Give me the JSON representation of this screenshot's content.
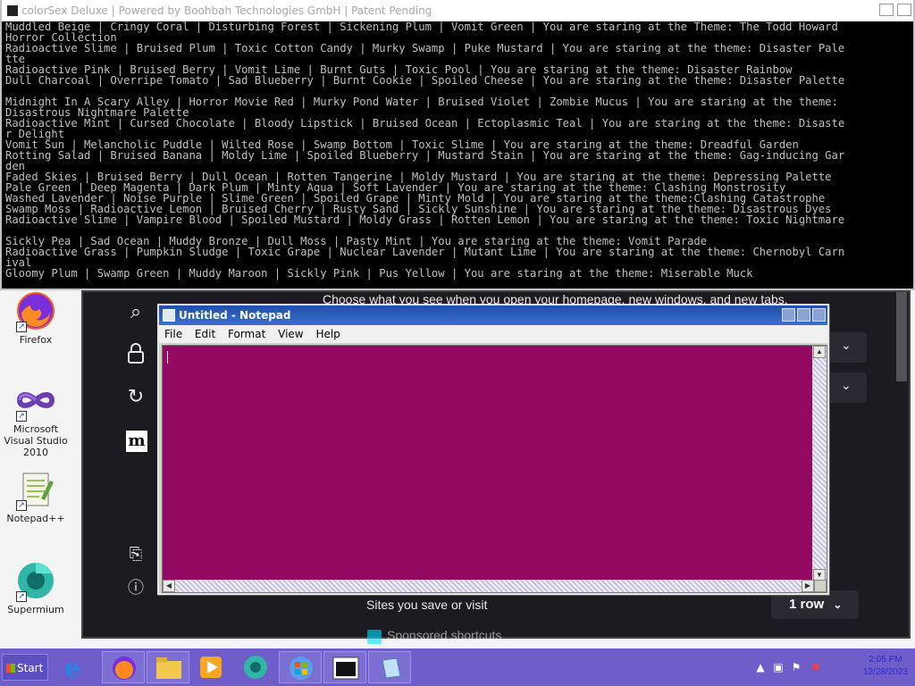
{
  "console": {
    "title": "colorSex Deluxe | Powered by Boohbah Technologies GmbH | Patent Pending",
    "lines": [
      "Muddled Beige | Cringy Coral | Disturbing Forest | Sickening Plum | Vomit Green | You are staring at the Theme: The Todd Howard",
      "Horror Collection",
      "Radioactive Slime | Bruised Plum | Toxic Cotton Candy | Murky Swamp | Puke Mustard | You are staring at the theme: Disaster Pale",
      "tte",
      "Radioactive Pink | Bruised Berry | Vomit Lime | Burnt Guts | Toxic Pool | You are staring at the theme: Disaster Rainbow",
      "Dull Charcoal | Overripe Tomato | Sad Blueberry | Burnt Cookie | Spoiled Cheese | You are staring at the theme: Disaster Palette",
      "",
      "Midnight In A Scary Alley | Horror Movie Red | Murky Pond Water | Bruised Violet | Zombie Mucus | You are staring at the theme:",
      "Disastrous Nightmare Palette",
      "Radioactive Mint | Cursed Chocolate | Bloody Lipstick | Bruised Ocean | Ectoplasmic Teal | You are staring at the theme: Disaste",
      "r Delight",
      "Vomit Sun | Melancholic Puddle | Wilted Rose | Swamp Bottom | Toxic Slime | You are staring at the theme: Dreadful Garden",
      "Rotting Salad | Bruised Banana | Moldy Lime | Spoiled Blueberry | Mustard Stain | You are staring at the theme: Gag-inducing Gar",
      "den",
      "Faded Skies | Bruised Berry | Dull Ocean | Rotten Tangerine | Moldy Mustard | You are staring at the theme: Depressing Palette",
      "Pale Green | Deep Magenta | Dark Plum | Minty Aqua | Soft Lavender | You are staring at the theme: Clashing Monstrosity",
      "Washed Lavender | Noise Purple | Slime Green | Spoiled Grape | Minty Mold | You are staring at the theme:Clashing Catastrophe",
      "Swamp Moss | Radioactive Lemon | Bruised Cherry | Rusty Sand | Sickly Sunshine | You are staring at the theme: Disastrous Dyes",
      "Radioactive Slime | Vampire Blood | Spoiled Mustard | Moldy Grass | Rotten Lemon | You are staring at the theme: Toxic Nightmare",
      "",
      "Sickly Pea | Sad Ocean | Muddy Bronze | Dull Moss | Pasty Mint | You are staring at the theme: Vomit Parade",
      "Radioactive Grass | Pumpkin Sludge | Toxic Grape | Nuclear Lavender | Mutant Lime | You are staring at the theme: Chernobyl Carn",
      "ival",
      "Gloomy Plum | Swamp Green | Muddy Maroon | Sickly Pink | Pus Yellow | You are staring at the theme: Miserable Muck"
    ]
  },
  "desktop_icons": [
    {
      "label": "Firefox",
      "icon": "firefox-icon"
    },
    {
      "label": "Microsoft Visual Studio 2010",
      "icon": "visual-studio-icon"
    },
    {
      "label": "Notepad++",
      "icon": "notepadpp-icon"
    },
    {
      "label": "Supermium",
      "icon": "supermium-icon"
    }
  ],
  "firefox": {
    "heading_partial": "Choose what you see when you open your homepage, new windows, and new tabs.",
    "sites_label": "Sites you save or visit",
    "rows_select": "1 row",
    "sponsored_label": "Sponsored shortcuts"
  },
  "notepad": {
    "title": "Untitled - Notepad",
    "menu": [
      "File",
      "Edit",
      "Format",
      "View",
      "Help"
    ],
    "text_color": "#ffffff",
    "background_color": "#930962"
  },
  "taskbar": {
    "start_label": "Start",
    "items": [
      "ie-icon",
      "firefox-icon",
      "explorer-icon",
      "media-player-icon",
      "supermium-icon",
      "windows-logo-icon",
      "console-icon",
      "notepad-icon"
    ],
    "clock_time": "2:05 PM",
    "clock_date": "12/28/2023"
  },
  "colors": {
    "taskbar": "#6f5ec9",
    "notepad_bg": "#930962",
    "console_bg": "#000000",
    "firefox_bg": "#1c1b22"
  }
}
